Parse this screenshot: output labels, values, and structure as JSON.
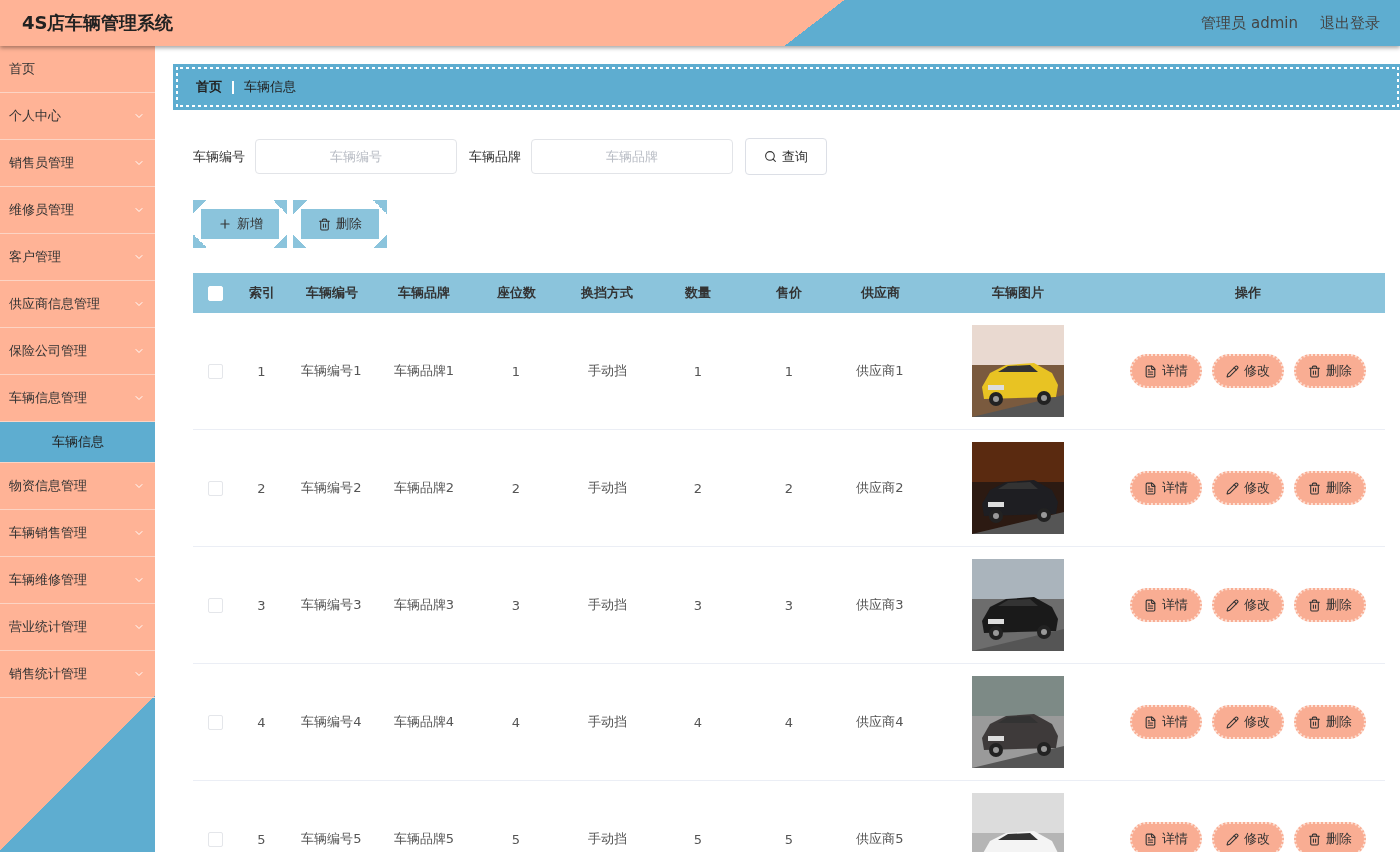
{
  "header": {
    "title": "4S店车辆管理系统",
    "user": "管理员 admin",
    "logout": "退出登录"
  },
  "sidebar": {
    "items": [
      {
        "label": "首页",
        "kind": "link"
      },
      {
        "label": "个人中心",
        "kind": "submenu"
      },
      {
        "label": "销售员管理",
        "kind": "submenu"
      },
      {
        "label": "维修员管理",
        "kind": "submenu"
      },
      {
        "label": "客户管理",
        "kind": "submenu"
      },
      {
        "label": "供应商信息管理",
        "kind": "submenu"
      },
      {
        "label": "保险公司管理",
        "kind": "submenu"
      },
      {
        "label": "车辆信息管理",
        "kind": "submenu",
        "children": [
          {
            "label": "车辆信息",
            "selected": true
          }
        ]
      },
      {
        "label": "物资信息管理",
        "kind": "submenu"
      },
      {
        "label": "车辆销售管理",
        "kind": "submenu"
      },
      {
        "label": "车辆维修管理",
        "kind": "submenu"
      },
      {
        "label": "营业统计管理",
        "kind": "submenu"
      },
      {
        "label": "销售统计管理",
        "kind": "submenu"
      }
    ]
  },
  "breadcrumb": [
    "首页",
    "车辆信息"
  ],
  "filters": [
    {
      "label": "车辆编号",
      "placeholder": "车辆编号"
    },
    {
      "label": "车辆品牌",
      "placeholder": "车辆品牌"
    }
  ],
  "search_button": "查询",
  "toolbar": [
    {
      "label": "新增",
      "kind": "add"
    },
    {
      "label": "删除",
      "kind": "delete"
    }
  ],
  "table": {
    "all_checked": false,
    "columns": [
      "索引",
      "车辆编号",
      "车辆品牌",
      "座位数",
      "换挡方式",
      "数量",
      "售价",
      "供应商",
      "车辆图片",
      "操作"
    ],
    "rows": [
      {
        "checked": false,
        "cells": [
          "1",
          "车辆编号1",
          "车辆品牌1",
          "1",
          "手动挡",
          "1",
          "1",
          "供应商1"
        ],
        "actions": [
          {
            "label": "详情",
            "kind": "detail"
          },
          {
            "label": "修改",
            "kind": "edit"
          },
          {
            "label": "删除",
            "kind": "delete"
          }
        ]
      },
      {
        "checked": false,
        "cells": [
          "2",
          "车辆编号2",
          "车辆品牌2",
          "2",
          "手动挡",
          "2",
          "2",
          "供应商2"
        ],
        "actions": [
          {
            "label": "详情",
            "kind": "detail"
          },
          {
            "label": "修改",
            "kind": "edit"
          },
          {
            "label": "删除",
            "kind": "delete"
          }
        ]
      },
      {
        "checked": false,
        "cells": [
          "3",
          "车辆编号3",
          "车辆品牌3",
          "3",
          "手动挡",
          "3",
          "3",
          "供应商3"
        ],
        "actions": [
          {
            "label": "详情",
            "kind": "detail"
          },
          {
            "label": "修改",
            "kind": "edit"
          },
          {
            "label": "删除",
            "kind": "delete"
          }
        ]
      },
      {
        "checked": false,
        "cells": [
          "4",
          "车辆编号4",
          "车辆品牌4",
          "4",
          "手动挡",
          "4",
          "4",
          "供应商4"
        ],
        "actions": [
          {
            "label": "详情",
            "kind": "detail"
          },
          {
            "label": "修改",
            "kind": "edit"
          },
          {
            "label": "删除",
            "kind": "delete"
          }
        ]
      },
      {
        "checked": false,
        "cells": [
          "5",
          "车辆编号5",
          "车辆品牌5",
          "5",
          "手动挡",
          "5",
          "5",
          "供应商5"
        ],
        "actions": [
          {
            "label": "详情",
            "kind": "detail"
          },
          {
            "label": "修改",
            "kind": "edit"
          },
          {
            "label": "删除",
            "kind": "delete"
          }
        ]
      }
    ]
  }
}
